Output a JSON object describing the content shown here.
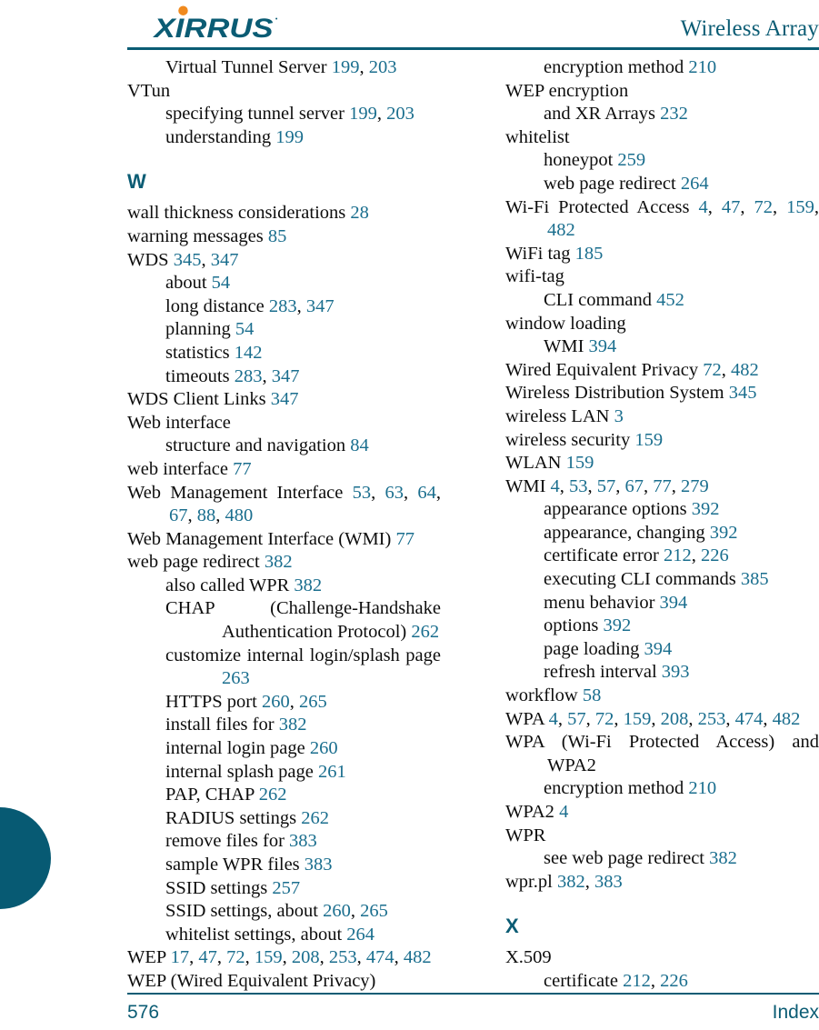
{
  "header": {
    "logo_text": "XIRRUS",
    "logo_trademark": "®",
    "title": "Wireless Array",
    "brand_color": "#0b5c74",
    "accent_color": "#f08a1e"
  },
  "footer": {
    "page_number": "576",
    "section": "Index"
  },
  "colors": {
    "page_ref": "#1a6e8e",
    "heading": "#0b5c74",
    "text": "#0d0d0d",
    "tab": "#075a73"
  },
  "left_column": {
    "entries": [
      {
        "level": 1,
        "text": "Virtual Tunnel Server",
        "pages": "199, 203"
      },
      {
        "level": 0,
        "text": "VTun",
        "pages": ""
      },
      {
        "level": 1,
        "text": "specifying tunnel server",
        "pages": "199, 203"
      },
      {
        "level": 1,
        "text": "understanding",
        "pages": "199"
      }
    ],
    "letter": "W",
    "entries_after": [
      {
        "level": 0,
        "text": "wall thickness considerations",
        "pages": "28"
      },
      {
        "level": 0,
        "text": "warning messages",
        "pages": "85"
      },
      {
        "level": 0,
        "text": "WDS",
        "pages": "345, 347"
      },
      {
        "level": 1,
        "text": "about",
        "pages": "54"
      },
      {
        "level": 1,
        "text": "long distance",
        "pages": "283, 347"
      },
      {
        "level": 1,
        "text": "planning",
        "pages": "54"
      },
      {
        "level": 1,
        "text": "statistics",
        "pages": "142"
      },
      {
        "level": 1,
        "text": "timeouts",
        "pages": "283, 347"
      },
      {
        "level": 0,
        "text": "WDS Client Links",
        "pages": "347"
      },
      {
        "level": 0,
        "text": "Web interface",
        "pages": ""
      },
      {
        "level": 1,
        "text": "structure and navigation",
        "pages": "84"
      },
      {
        "level": 0,
        "text": "web interface",
        "pages": "77"
      },
      {
        "level": 0,
        "text": "Web Management Interface",
        "pages": "53, 63, 64, 67, 88, 480",
        "wrap": true
      },
      {
        "level": 0,
        "text": "Web Management Interface (WMI)",
        "pages": "77"
      },
      {
        "level": 0,
        "text": "web page redirect",
        "pages": "382"
      },
      {
        "level": 1,
        "text": "also called WPR",
        "pages": "382"
      },
      {
        "level": 1,
        "text": "CHAP (Challenge-Handshake Authentication Protocol)",
        "pages": "262",
        "wrap": true
      },
      {
        "level": 1,
        "text": "customize internal login/splash page",
        "pages": "263",
        "wrap": true
      },
      {
        "level": 1,
        "text": "HTTPS port",
        "pages": "260, 265"
      },
      {
        "level": 1,
        "text": "install files for",
        "pages": "382"
      },
      {
        "level": 1,
        "text": "internal login page",
        "pages": "260"
      },
      {
        "level": 1,
        "text": "internal splash page",
        "pages": "261"
      },
      {
        "level": 1,
        "text": "PAP, CHAP",
        "pages": "262"
      },
      {
        "level": 1,
        "text": "RADIUS settings",
        "pages": "262"
      },
      {
        "level": 1,
        "text": "remove files for",
        "pages": "383"
      },
      {
        "level": 1,
        "text": "sample WPR files",
        "pages": "383"
      },
      {
        "level": 1,
        "text": "SSID settings",
        "pages": "257"
      },
      {
        "level": 1,
        "text": "SSID settings, about",
        "pages": "260, 265"
      },
      {
        "level": 1,
        "text": "whitelist settings, about",
        "pages": "264"
      },
      {
        "level": 0,
        "text": "WEP",
        "pages": "17, 47, 72, 159, 208, 253, 474, 482"
      },
      {
        "level": 0,
        "text": "WEP (Wired Equivalent Privacy)",
        "pages": ""
      }
    ]
  },
  "right_column": {
    "entries": [
      {
        "level": 1,
        "text": "encryption method",
        "pages": "210"
      },
      {
        "level": 0,
        "text": "WEP encryption",
        "pages": ""
      },
      {
        "level": 1,
        "text": "and XR Arrays",
        "pages": "232"
      },
      {
        "level": 0,
        "text": "whitelist",
        "pages": ""
      },
      {
        "level": 1,
        "text": "honeypot",
        "pages": "259"
      },
      {
        "level": 1,
        "text": "web page redirect",
        "pages": "264"
      },
      {
        "level": 0,
        "text": "Wi-Fi Protected Access",
        "pages": "4, 47, 72, 159, 482",
        "wrap": true
      },
      {
        "level": 0,
        "text": "WiFi tag",
        "pages": "185"
      },
      {
        "level": 0,
        "text": "wifi-tag",
        "pages": ""
      },
      {
        "level": 1,
        "text": "CLI command",
        "pages": "452"
      },
      {
        "level": 0,
        "text": "window loading",
        "pages": ""
      },
      {
        "level": 1,
        "text": "WMI",
        "pages": "394"
      },
      {
        "level": 0,
        "text": "Wired Equivalent Privacy",
        "pages": "72, 482"
      },
      {
        "level": 0,
        "text": "Wireless Distribution System",
        "pages": "345"
      },
      {
        "level": 0,
        "text": "wireless LAN",
        "pages": "3"
      },
      {
        "level": 0,
        "text": "wireless security",
        "pages": "159"
      },
      {
        "level": 0,
        "text": "WLAN",
        "pages": "159"
      },
      {
        "level": 0,
        "text": "WMI",
        "pages": "4, 53, 57, 67, 77, 279"
      },
      {
        "level": 1,
        "text": "appearance options",
        "pages": "392"
      },
      {
        "level": 1,
        "text": "appearance, changing",
        "pages": "392"
      },
      {
        "level": 1,
        "text": "certificate error",
        "pages": "212, 226"
      },
      {
        "level": 1,
        "text": "executing CLI commands",
        "pages": "385"
      },
      {
        "level": 1,
        "text": "menu behavior",
        "pages": "394"
      },
      {
        "level": 1,
        "text": "options",
        "pages": "392"
      },
      {
        "level": 1,
        "text": "page loading",
        "pages": "394"
      },
      {
        "level": 1,
        "text": "refresh interval",
        "pages": "393"
      },
      {
        "level": 0,
        "text": "workflow",
        "pages": "58"
      },
      {
        "level": 0,
        "text": "WPA",
        "pages": "4, 57, 72, 159, 208, 253, 474, 482"
      },
      {
        "level": 0,
        "text": "WPA (Wi-Fi Protected Access) and WPA2",
        "pages": "",
        "wrap": true
      },
      {
        "level": 1,
        "text": "encryption method",
        "pages": "210"
      },
      {
        "level": 0,
        "text": "WPA2",
        "pages": "4"
      },
      {
        "level": 0,
        "text": "WPR",
        "pages": ""
      },
      {
        "level": 1,
        "text": "see web page redirect",
        "pages": "382"
      },
      {
        "level": 0,
        "text": "wpr.pl",
        "pages": "382, 383"
      }
    ],
    "letter": "X",
    "entries_after": [
      {
        "level": 0,
        "text": "X.509",
        "pages": ""
      },
      {
        "level": 1,
        "text": "certificate",
        "pages": "212, 226"
      }
    ]
  }
}
